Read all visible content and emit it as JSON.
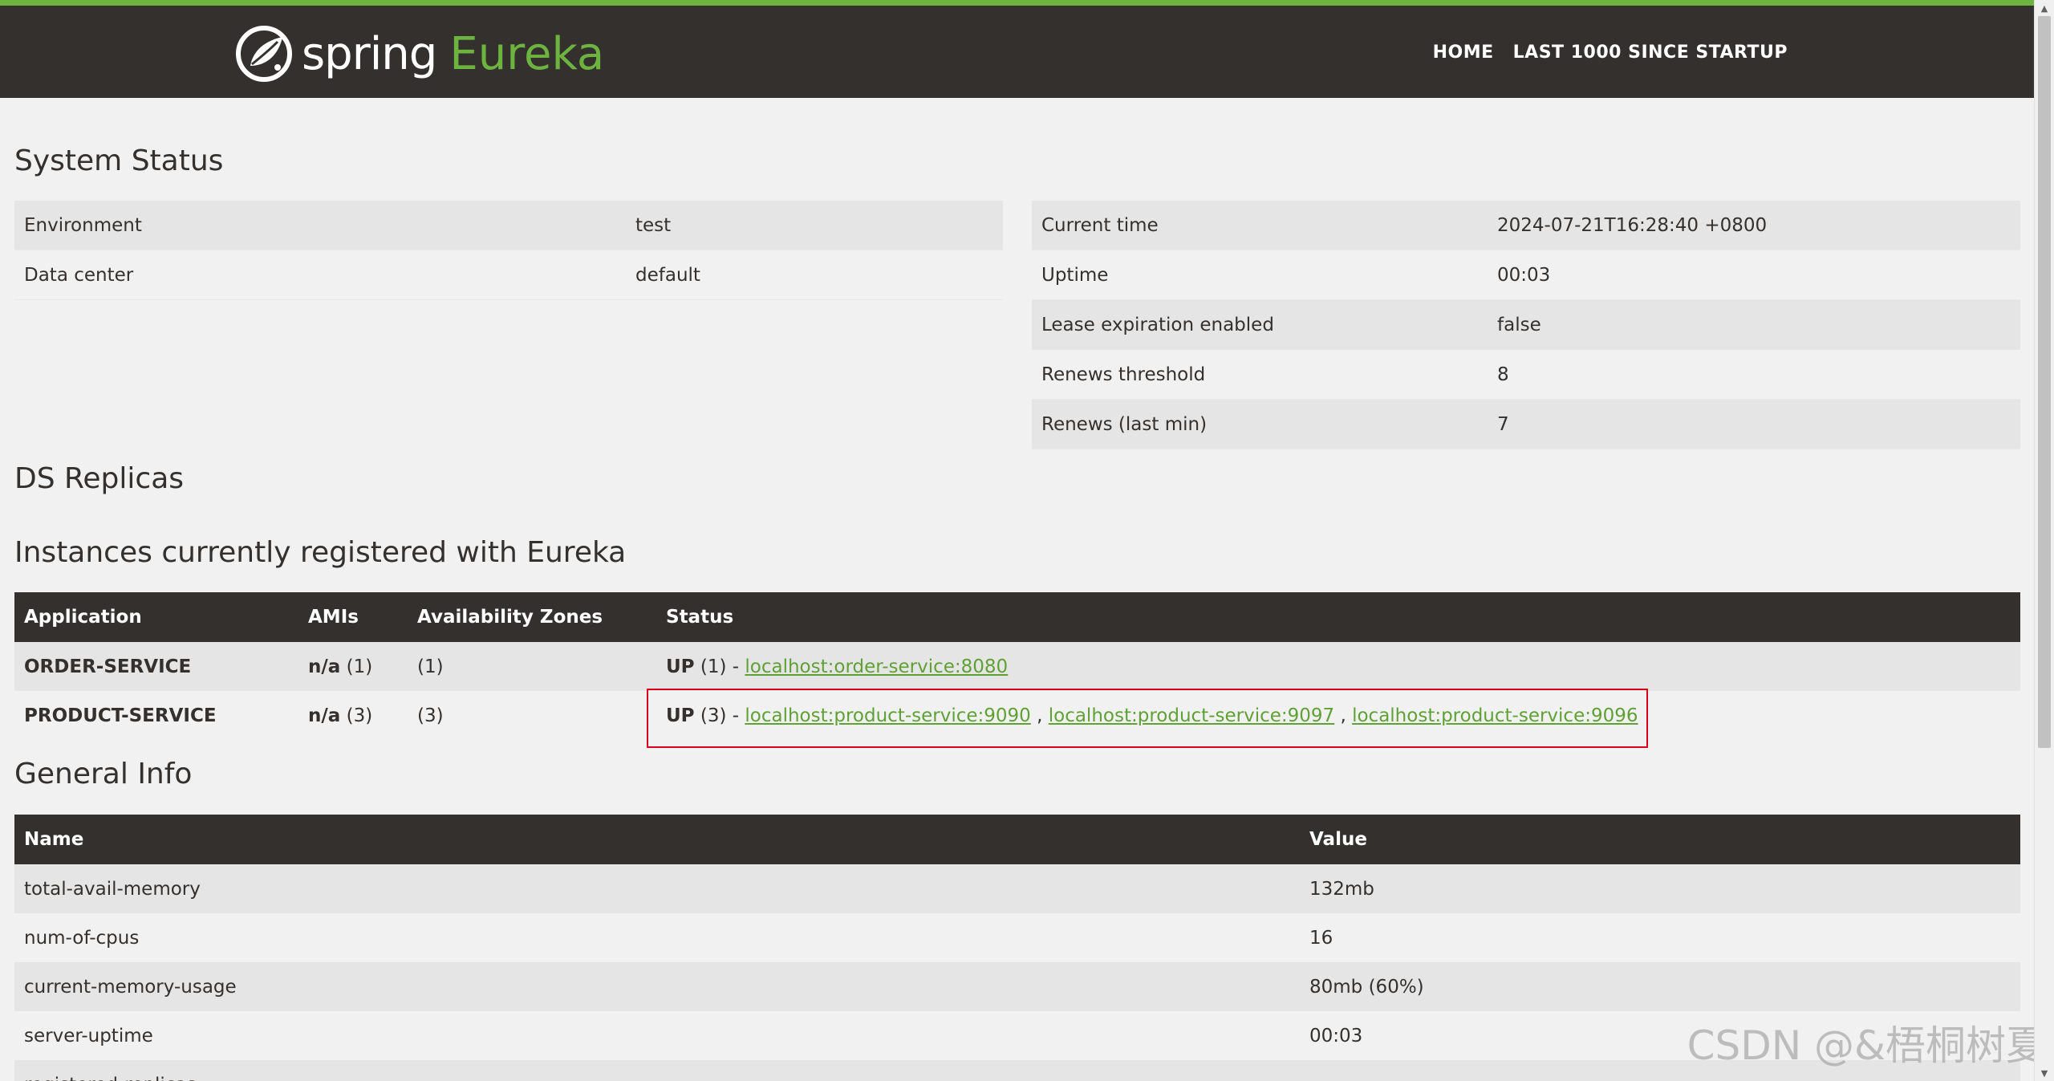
{
  "header": {
    "logo_spring": "spring",
    "logo_eureka": "Eureka",
    "nav": [
      "HOME",
      "LAST 1000 SINCE STARTUP"
    ],
    "accent_color": "#6db33f",
    "bar_color": "#34302d"
  },
  "system_status": {
    "title": "System Status",
    "left": [
      {
        "label": "Environment",
        "value": "test"
      },
      {
        "label": "Data center",
        "value": "default"
      }
    ],
    "right": [
      {
        "label": "Current time",
        "value": "2024-07-21T16:28:40 +0800"
      },
      {
        "label": "Uptime",
        "value": "00:03"
      },
      {
        "label": "Lease expiration enabled",
        "value": "false"
      },
      {
        "label": "Renews threshold",
        "value": "8"
      },
      {
        "label": "Renews (last min)",
        "value": "7"
      }
    ]
  },
  "ds_replicas": {
    "title": "DS Replicas"
  },
  "instances": {
    "title": "Instances currently registered with Eureka",
    "columns": [
      "Application",
      "AMIs",
      "Availability Zones",
      "Status"
    ],
    "rows": [
      {
        "application": "ORDER-SERVICE",
        "amis_label": "n/a",
        "amis_count": "(1)",
        "zones": "(1)",
        "status_label": "UP",
        "status_count": "(1) -",
        "links": [
          "localhost:order-service:8080"
        ]
      },
      {
        "application": "PRODUCT-SERVICE",
        "amis_label": "n/a",
        "amis_count": "(3)",
        "zones": "(3)",
        "status_label": "UP",
        "status_count": "(3) -",
        "links": [
          "localhost:product-service:9090",
          "localhost:product-service:9097",
          "localhost:product-service:9096"
        ]
      }
    ],
    "link_separator": ","
  },
  "general_info": {
    "title": "General Info",
    "columns": [
      "Name",
      "Value"
    ],
    "rows": [
      {
        "name": "total-avail-memory",
        "value": "132mb"
      },
      {
        "name": "num-of-cpus",
        "value": "16"
      },
      {
        "name": "current-memory-usage",
        "value": "80mb (60%)"
      },
      {
        "name": "server-uptime",
        "value": "00:03"
      },
      {
        "name": "registered-replicas",
        "value": ""
      }
    ]
  },
  "watermark": "CSDN @&梧桐树夏"
}
